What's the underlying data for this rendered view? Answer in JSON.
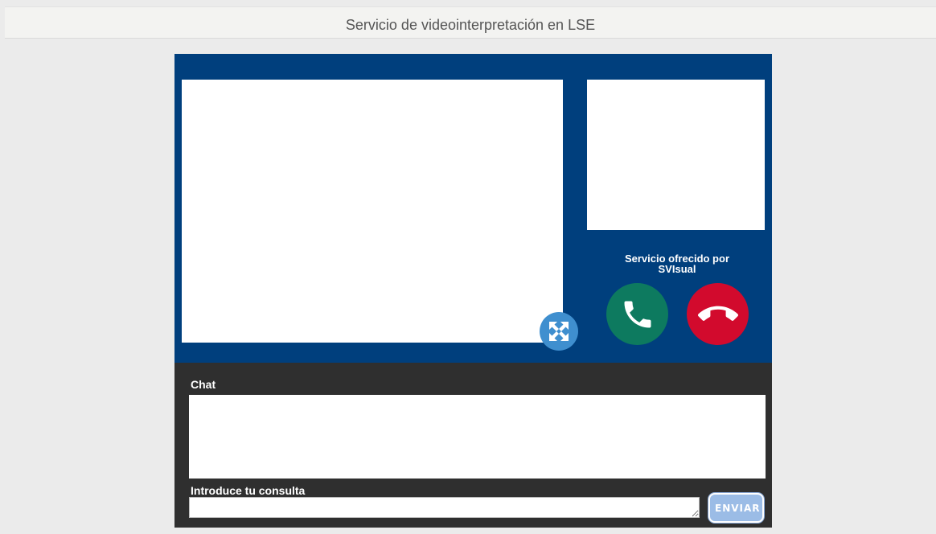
{
  "header": {
    "title": "Servicio de videointerpretación en LSE"
  },
  "video": {
    "provider_line1": "Servicio ofrecido por",
    "provider_line2": "SVIsual"
  },
  "icons": {
    "fullscreen": "expand-arrows-icon",
    "call": "phone-answer-icon",
    "hangup": "phone-hangup-icon"
  },
  "chat": {
    "title": "Chat",
    "query_label": "Introduce tu consulta",
    "query_value": "",
    "send_label": "ENVIAR"
  },
  "colors": {
    "video_bg": "#003f7d",
    "chat_bg": "#2f2f2f",
    "call_green": "#0d7a5f",
    "hangup_red": "#d20a2d",
    "fullscreen_blue": "#3f8fcf",
    "send_button": "#9bbce6"
  }
}
